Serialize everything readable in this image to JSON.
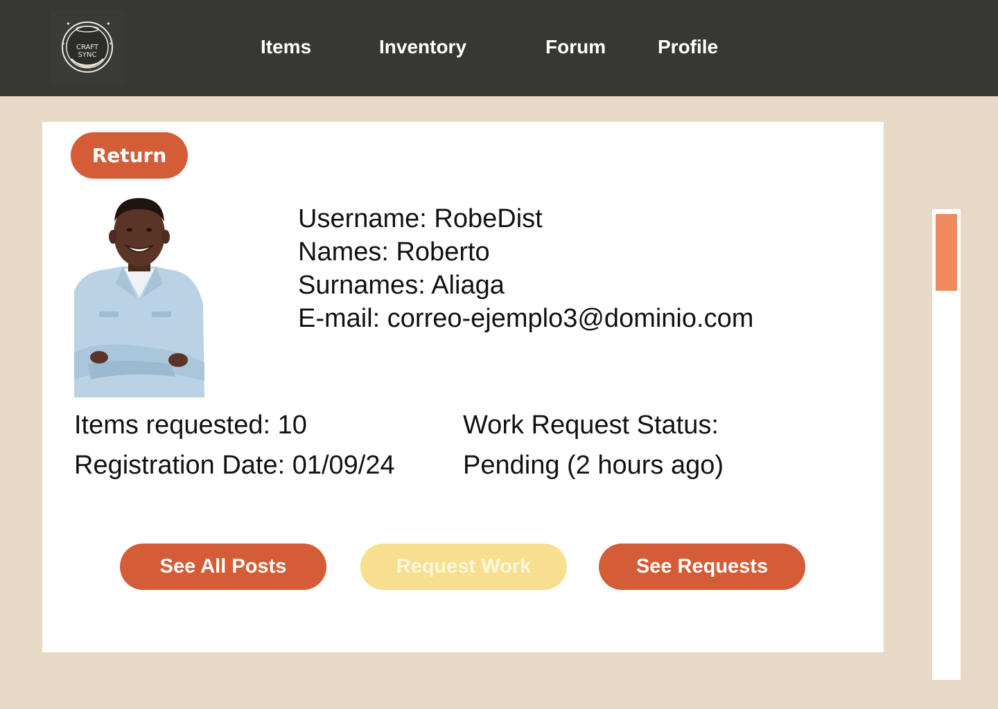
{
  "app": {
    "logo_text": [
      "CRAFT",
      "SYNC"
    ]
  },
  "nav": {
    "items": [
      {
        "label": "Items"
      },
      {
        "label": "Inventory"
      },
      {
        "label": "Forum"
      },
      {
        "label": "Profile"
      }
    ]
  },
  "card": {
    "return_label": "Return",
    "profile": {
      "username": "Username: RobeDist",
      "names": "Names: Roberto",
      "surnames": "Surnames: Aliaga",
      "email": "E-mail: correo-ejemplo3@dominio.com"
    },
    "stats": {
      "items_requested": "Items requested: 10",
      "registration_date": "Registration Date: 01/09/24",
      "work_status_label": "Work Request Status:",
      "work_status_value": "Pending (2 hours ago)"
    },
    "actions": {
      "see_all_posts": "See All Posts",
      "request_work": "Request Work",
      "see_requests": "See Requests"
    }
  },
  "colors": {
    "topbar": "#373834",
    "page_bg": "#e8d8c6",
    "primary_button": "#d45c36",
    "disabled_button": "#f7df8f",
    "scroll_thumb": "#ee8a5e"
  },
  "scrollbar": {
    "position_fraction": 0.0
  }
}
